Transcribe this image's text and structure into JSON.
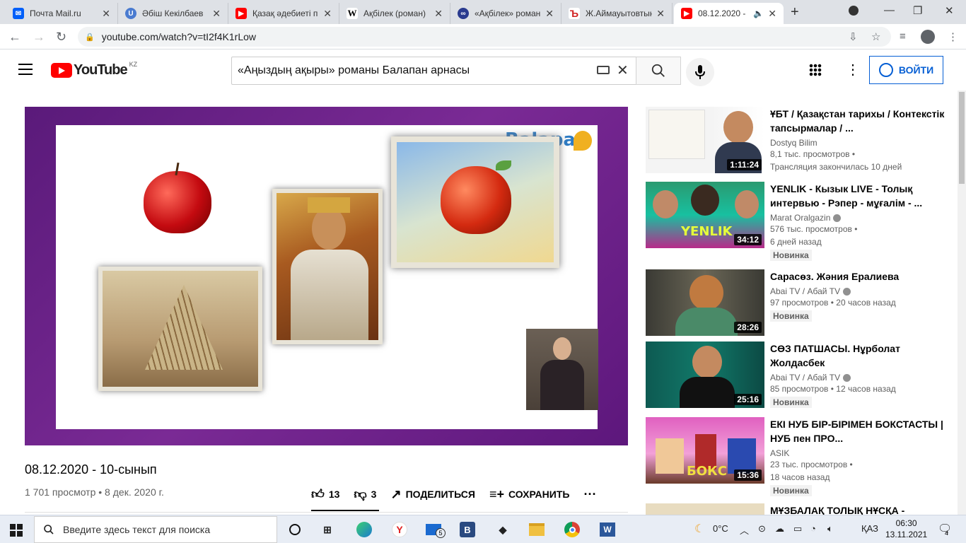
{
  "browser": {
    "tabs": [
      {
        "title": "Почта Mail.ru",
        "icon": "mail-icon",
        "color": "#005ff9"
      },
      {
        "title": "Әбіш Кекілбаев",
        "icon": "u-icon",
        "color": "#4a7bd0"
      },
      {
        "title": "Қазақ әдебиеті п",
        "icon": "youtube-icon",
        "color": "#ff0000"
      },
      {
        "title": "Ақбілек (роман)",
        "icon": "wikipedia-icon",
        "color": "#333333"
      },
      {
        "title": "«Ақбілек» роман",
        "icon": "globe-icon",
        "color": "#2a3b8f"
      },
      {
        "title": "Ж.Аймауытовтың",
        "icon": "b-icon",
        "color": "#d02020"
      },
      {
        "title": "08.12.2020 -",
        "icon": "youtube-icon",
        "color": "#ff0000",
        "active": true
      }
    ],
    "url": "youtube.com/watch?v=tI2f4K1rLow"
  },
  "header": {
    "logo_text": "YouTube",
    "region": "KZ",
    "search_value": "«Аңыздың ақыры» романы Балапан арнасы",
    "login_label": "ВОЙТИ"
  },
  "video": {
    "watermark": "Balapan",
    "title": "08.12.2020 - 10-сынып",
    "meta": "1 701 просмотр • 8 дек. 2020 г.",
    "likes": "13",
    "dislikes": "3",
    "share_label": "ПОДЕЛИТЬСЯ",
    "save_label": "СОХРАНИТЬ"
  },
  "recommendations": [
    {
      "title": "ҰБТ / Қазақстан тарихы / Контекстік тапсырмалар / ...",
      "channel": "Dostyq Bilim",
      "verified": false,
      "line1": "8,1 тыс. просмотров •",
      "line2": "Трансляция закончилась 10 дней",
      "badge": "",
      "duration": "1:11:24"
    },
    {
      "title": "YENLIK - Кызык LIVE - Толық интервью - Рэпер - мұғалім - ...",
      "channel": "Marat Oralgazin",
      "verified": true,
      "line1": "576 тыс. просмотров •",
      "line2": "6 дней назад",
      "badge": "Новинка",
      "duration": "34:12"
    },
    {
      "title": "Сарасөз. Жәния Ералиева",
      "channel": "Abai TV / Абай TV",
      "verified": true,
      "line1": "97 просмотров • 20 часов назад",
      "line2": "",
      "badge": "Новинка",
      "duration": "28:26"
    },
    {
      "title": "СӨЗ ПАТШАСЫ. Нұрболат Жолдасбек",
      "channel": "Abai TV / Абай TV",
      "verified": true,
      "line1": "85 просмотров • 12 часов назад",
      "line2": "",
      "badge": "Новинка",
      "duration": "25:16"
    },
    {
      "title": "ЕКІ НУБ БІР-БІРІМЕН БОКСТАСТЫ | НУБ пен ПРО...",
      "channel": "ASIK",
      "verified": false,
      "line1": "23 тыс. просмотров •",
      "line2": "18 часов назад",
      "badge": "Новинка",
      "duration": "15:36"
    },
    {
      "title": "МҰЗБАЛАҚ ТОЛЫҚ НҰСҚА -",
      "channel": "",
      "verified": false,
      "line1": "",
      "line2": "",
      "badge": "",
      "duration": ""
    }
  ],
  "taskbar": {
    "search_placeholder": "Введите здесь текст для поиска",
    "weather": "0°C",
    "lang": "ҚАЗ",
    "time": "06:30",
    "date": "13.11.2021",
    "mail_count": "5",
    "notif_count": "4"
  }
}
